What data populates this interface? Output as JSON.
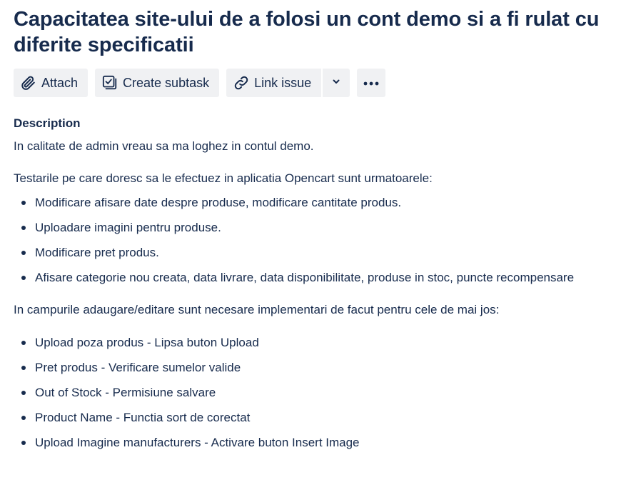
{
  "issue": {
    "title": "Capacitatea site-ului de a folosi un cont demo si a fi rulat cu diferite specificatii"
  },
  "toolbar": {
    "attach_label": "Attach",
    "create_subtask_label": "Create subtask",
    "link_issue_label": "Link issue"
  },
  "description": {
    "heading": "Description",
    "paragraph1": "In calitate de admin vreau sa ma loghez in contul demo.",
    "paragraph2": "Testarile pe care doresc sa le efectuez in aplicatia Opencart sunt urmatoarele:",
    "list1": [
      "Modificare afisare date despre produse, modificare cantitate produs.",
      "Uploadare imagini pentru produse.",
      "Modificare pret produs.",
      "Afisare categorie nou creata, data livrare, data disponibilitate, produse in stoc, puncte recompensare"
    ],
    "paragraph3": "In campurile adaugare/editare sunt necesare implementari de facut pentru cele de mai jos:",
    "list2": [
      "Upload poza produs - Lipsa buton Upload",
      "Pret produs - Verificare sumelor valide",
      "Out of Stock - Permisiune salvare",
      "Product Name - Functia sort de corectat",
      "Upload Imagine manufacturers - Activare buton Insert Image"
    ]
  }
}
